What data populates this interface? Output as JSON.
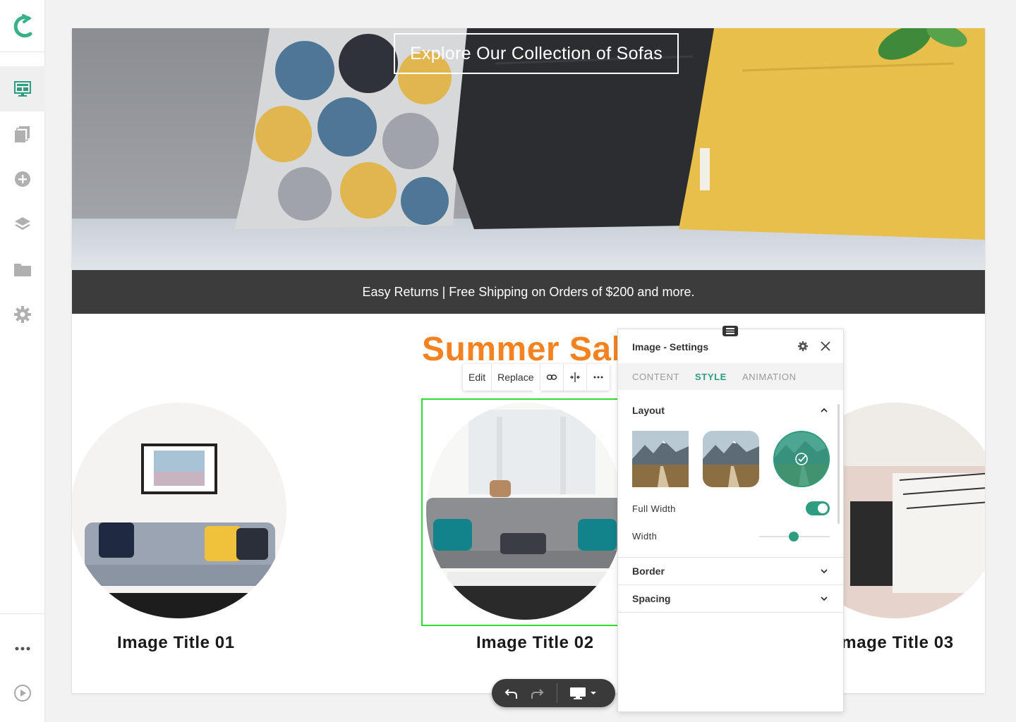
{
  "sidebar": {
    "logo": "c-logo-icon",
    "items": [
      {
        "icon": "layout-icon",
        "active": true
      },
      {
        "icon": "pages-icon",
        "active": false
      },
      {
        "icon": "add-circle-icon",
        "active": false
      },
      {
        "icon": "layers-icon",
        "active": false
      },
      {
        "icon": "folder-icon",
        "active": false
      },
      {
        "icon": "gear-icon",
        "active": false
      }
    ],
    "bottom_items": [
      {
        "icon": "more-icon"
      },
      {
        "icon": "play-icon"
      }
    ]
  },
  "canvas": {
    "hero_title": "Explore Our Collection of  Sofas",
    "promo_text": "Easy Returns | Free Shipping on Orders of $200 and more.",
    "section_heading": "Summer Sale",
    "images": [
      {
        "title": "Image Title 01"
      },
      {
        "title": "Image Title 02"
      },
      {
        "title": "Image Title 03"
      }
    ]
  },
  "image_toolbar": {
    "edit": "Edit",
    "replace": "Replace",
    "icons": [
      "link-icon",
      "align-icon",
      "more-icon"
    ]
  },
  "settings_panel": {
    "title": "Image - Settings",
    "tabs": [
      "CONTENT",
      "STYLE",
      "ANIMATION"
    ],
    "active_tab": "STYLE",
    "layout": {
      "label": "Layout",
      "options": [
        "square",
        "rounded",
        "circle"
      ],
      "selected": "circle"
    },
    "full_width": {
      "label": "Full Width",
      "value": true
    },
    "width": {
      "label": "Width",
      "value_fraction": 0.5
    },
    "sections": [
      "Border",
      "Spacing"
    ]
  },
  "bottom_toolbar": {
    "icons": [
      "undo-icon",
      "redo-icon",
      "desktop-icon",
      "caret-down-icon"
    ]
  },
  "colors": {
    "accent": "#2e9c7e",
    "sale_orange": "#f58220",
    "selection_green": "#2fdc2f",
    "promo_bar": "#3c3c3c"
  }
}
